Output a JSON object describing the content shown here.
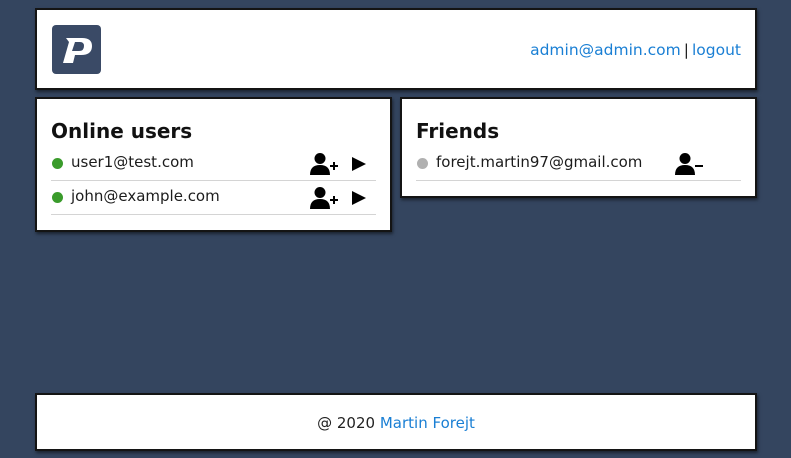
{
  "header": {
    "logo_icon": "p-logo-icon",
    "user_email": "admin@admin.com",
    "separator": "|",
    "logout_label": "logout"
  },
  "online": {
    "title": "Online users",
    "users": [
      {
        "email": "user1@test.com",
        "status": "online",
        "add_icon": "user-plus-icon",
        "chat_icon": "play-icon"
      },
      {
        "email": "john@example.com",
        "status": "online",
        "add_icon": "user-plus-icon",
        "chat_icon": "play-icon"
      }
    ]
  },
  "friends": {
    "title": "Friends",
    "users": [
      {
        "email": "forejt.martin97@gmail.com",
        "status": "offline",
        "remove_icon": "user-minus-icon"
      }
    ]
  },
  "footer": {
    "prefix": "@ 2020",
    "author": "Martin Forejt"
  },
  "colors": {
    "background": "#34455f",
    "link": "#1a7fd4",
    "online_dot": "#3a9b2b",
    "offline_dot": "#b0b0b0",
    "logo_bg": "#3a4a66"
  }
}
